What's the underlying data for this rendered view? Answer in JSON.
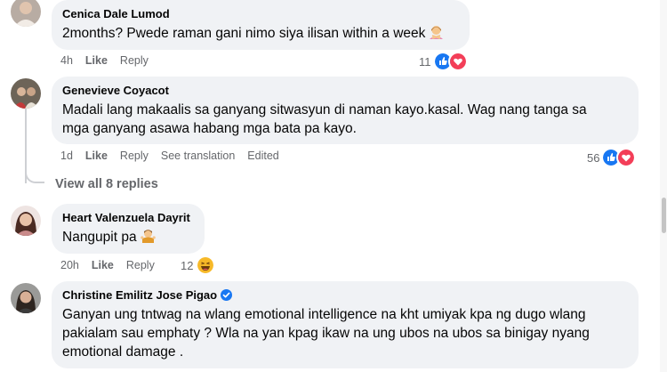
{
  "comments": [
    {
      "author": "Cenica Dale Lumod",
      "text": "2months? Pwede raman gani nimo siya ilisan within a week",
      "time": "4h",
      "like": "Like",
      "reply": "Reply",
      "reaction_count": "11",
      "emoji": "person-gesturing-no-emoji"
    },
    {
      "author": "Genevieve Coyacot",
      "text_line1": "Madali lang makaalis sa ganyang sitwasyun di naman kayo.kasal. Wag nang tanga sa",
      "text_line2": "mga ganyang asawa habang mga bata pa kayo.",
      "time": "1d",
      "like": "Like",
      "reply": "Reply",
      "see_translation": "See translation",
      "edited": "Edited",
      "reaction_count": "56"
    },
    {
      "author": "Heart Valenzuela Dayrit",
      "text": "Nangupit pa",
      "time": "20h",
      "like": "Like",
      "reply": "Reply",
      "reaction_count": "12",
      "emoji": "person-shrugging-emoji"
    },
    {
      "author": "Christine Emilitz Jose Pigao",
      "verified": true,
      "text_line1": "Ganyan ung tntwag na wlang emotional intelligence na kht umiyak kpa ng dugo wlang",
      "text_line2": "pakialam sau emphaty ? Wla na yan kpag ikaw na ung ubos na ubos sa binigay nyang",
      "text_line3": "emotional damage ."
    }
  ],
  "view_replies": "View all 8 replies",
  "colors": {
    "bubble": "#f0f2f5",
    "muted_text": "#65676b",
    "like_blue": "#1877f2",
    "love_red": "#f33e58",
    "haha_yellow": "#f7b928"
  }
}
